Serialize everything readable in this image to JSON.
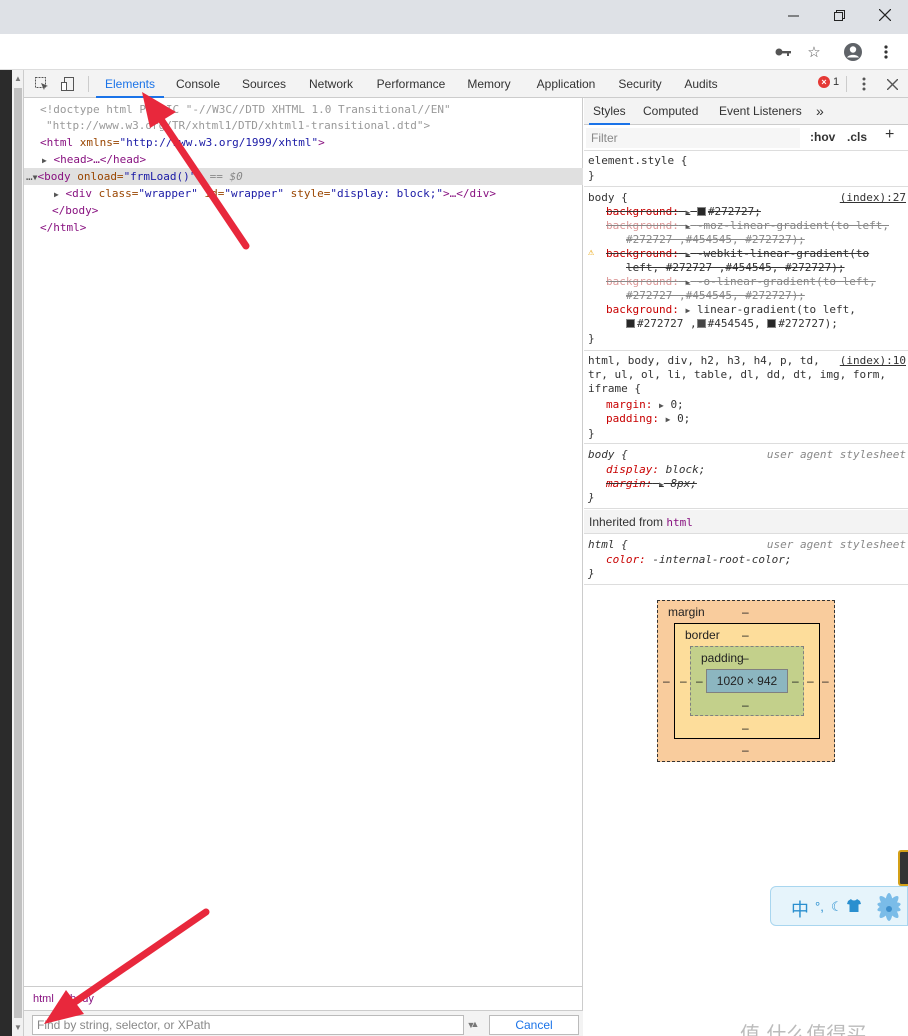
{
  "window": {
    "minimize_icon": "minimize-icon",
    "maximize_icon": "restore-icon",
    "close_icon": "close-icon"
  },
  "toolbar_icons": [
    "key-icon",
    "star-icon",
    "account-icon",
    "more-vert-icon"
  ],
  "devtools": {
    "tabs": [
      {
        "label": "Elements",
        "active": true
      },
      {
        "label": "Console"
      },
      {
        "label": "Sources"
      },
      {
        "label": "Network"
      },
      {
        "label": "Performance"
      },
      {
        "label": "Memory"
      },
      {
        "label": "Application"
      },
      {
        "label": "Security"
      },
      {
        "label": "Audits"
      }
    ],
    "error_count": "1"
  },
  "tree": {
    "doctype_1": "<!doctype html PUBLIC \"-//W3C//DTD XHTML 1.0 Transitional//EN\"",
    "doctype_2": "\"http://www.w3.org/TR/xhtml1/DTD/xhtml1-transitional.dtd\">",
    "html_open_tag": "<html",
    "html_attr": " xmlns=",
    "html_val": "\"http://www.w3.org/1999/xhtml\"",
    "html_close": ">",
    "head_line": "<head>…</head>",
    "body_open": "<body",
    "body_attr": " onload=",
    "body_val": "\"frmLoad()\"",
    "body_end": ">",
    "body_eq": " == $0",
    "div_open": "<div",
    "div_attr1": " class=",
    "div_val1": "\"wrapper\"",
    "div_attr2": " id=",
    "div_val2": "\"wrapper\"",
    "div_attr3": " style=",
    "div_val3": "\"display: block;\"",
    "div_end": ">…</div>",
    "body_close": "</body>",
    "html_close_tag": "</html>"
  },
  "breadcrumb": [
    "html",
    "body"
  ],
  "search": {
    "placeholder": "Find by string, selector, or XPath",
    "cancel": "Cancel"
  },
  "styles": {
    "tabs": [
      "Styles",
      "Computed",
      "Event Listeners",
      "»"
    ],
    "filter_placeholder": "Filter",
    "hov": ":hov",
    "cls": ".cls",
    "plus": "+",
    "element_style": "element.style {",
    "close_brace": "}",
    "body_rule": {
      "selector": "body {",
      "source": "(index):27",
      "bg1_prop": "background:",
      "bg1_val": "#272727;",
      "bg2_prop": "background:",
      "bg2_val_1": "-moz-linear-gradient(to left,",
      "bg2_val_2": "#272727 ,#454545, #272727);",
      "bg3_prop": "background:",
      "bg3_val_1": "-webkit-linear-gradient(to",
      "bg3_val_2": "left, #272727 ,#454545, #272727);",
      "bg4_prop": "background:",
      "bg4_val_1": "-o-linear-gradient(to left,",
      "bg4_val_2": "#272727 ,#454545, #272727);",
      "bg5_prop": "background:",
      "bg5_val_1": "linear-gradient(to left,",
      "bg5_c1": "#272727 ,",
      "bg5_c2": "#454545,",
      "bg5_c3": "#272727);"
    },
    "reset_rule": {
      "selector_1": "html, body, div, h2, h3, h4, p, td,",
      "selector_2": "tr, ul, ol, li, table, dl, dd, dt, img, form,",
      "selector_3": "iframe {",
      "source": "(index):10",
      "margin_prop": "margin:",
      "margin_val": "0;",
      "padding_prop": "padding:",
      "padding_val": "0;"
    },
    "ua_body": {
      "selector": "body {",
      "source": "user agent stylesheet",
      "display_prop": "display:",
      "display_val": "block;",
      "margin_prop": "margin:",
      "margin_val": "8px;"
    },
    "inherited_label": "Inherited from",
    "inherited_tag": "html",
    "ua_html": {
      "selector": "html {",
      "source": "user agent stylesheet",
      "color_prop": "color:",
      "color_val": "-internal-root-color;"
    },
    "box_model": {
      "margin_label": "margin",
      "border_label": "border",
      "padding_label": "padding",
      "content_size": "1020 × 942",
      "dash": "–"
    }
  },
  "widget": {
    "zh_char": "中"
  },
  "watermark": "值 什么值得买",
  "colors": {
    "accent": "#1a73e8",
    "tag": "#881280",
    "attr": "#994500",
    "value": "#1a1aa6",
    "arrow": "#e8283c"
  }
}
